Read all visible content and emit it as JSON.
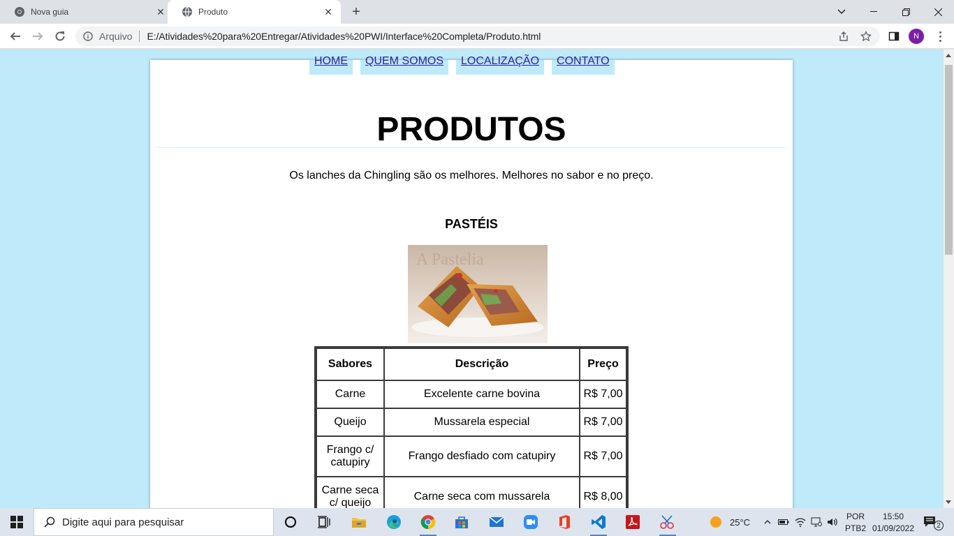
{
  "browser": {
    "tabs": [
      {
        "title": "Nova guia",
        "active": false
      },
      {
        "title": "Produto",
        "active": true
      }
    ],
    "address": {
      "scheme_label": "Arquivo",
      "url": "E:/Atividades%20para%20Entregar/Atividades%20PWI/Interface%20Completa/Produto.html"
    },
    "profile_initial": "N"
  },
  "page": {
    "nav": [
      "HOME",
      "QUEM SOMOS",
      "LOCALIZAÇÃO",
      "CONTATO"
    ],
    "title": "PRODUTOS",
    "intro": "Os lanches da Chingling são os melhores. Melhores no sabor e no preço.",
    "section_title": "PASTÉIS",
    "image_watermark": "A Pastelia",
    "table": {
      "headers": [
        "Sabores",
        "Descrição",
        "Preço"
      ],
      "rows": [
        [
          "Carne",
          "Excelente carne bovina",
          "R$ 7,00"
        ],
        [
          "Queijo",
          "Mussarela especial",
          "R$ 7,00"
        ],
        [
          "Frango c/ catupiry",
          "Frango desfiado com catupiry",
          "R$ 7,00"
        ],
        [
          "Carne seca c/ queijo",
          "Carne seca com mussarela",
          "R$ 8,00"
        ]
      ]
    }
  },
  "taskbar": {
    "search_placeholder": "Digite aqui para pesquisar",
    "weather": "25°C",
    "language": "POR",
    "layout": "PTB2",
    "time": "15:50",
    "date": "01/09/2022",
    "notifications": "2"
  },
  "colors": {
    "page_background": "#bfeafa",
    "nav_background": "#bfeafa",
    "link": "#2a1fa8"
  }
}
